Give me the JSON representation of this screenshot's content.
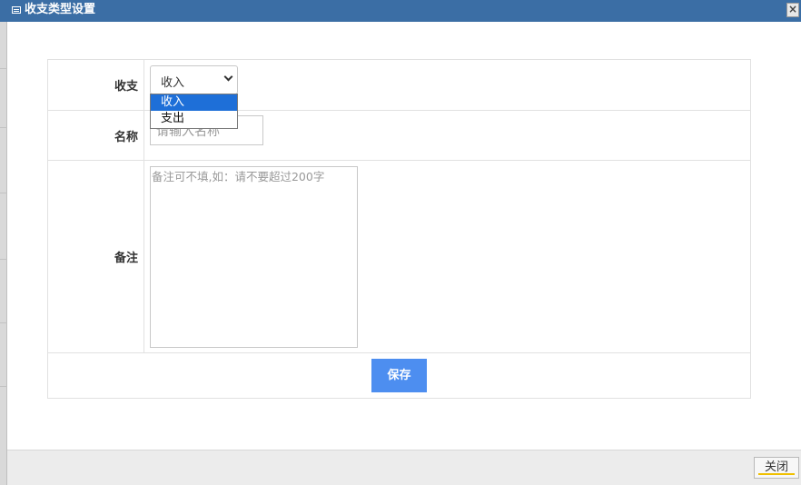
{
  "window": {
    "title": "收支类型设置",
    "close_symbol": "×"
  },
  "form": {
    "type_label": "收支",
    "type_selected": "收入",
    "type_options": [
      "收入",
      "支出"
    ],
    "name_label": "名称",
    "name_placeholder": "请输入名称",
    "remark_label": "备注",
    "remark_placeholder": "备注可不填,如：请不要超过200字",
    "save_label": "保存"
  },
  "footer": {
    "close_label": "关闭"
  },
  "colors": {
    "titlebar": "#3b6ea5",
    "save_button": "#4d8ef0",
    "dropdown_highlight": "#1e6fd8"
  }
}
